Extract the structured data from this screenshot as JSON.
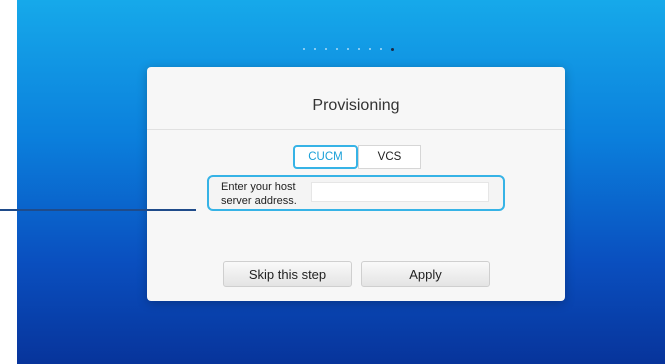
{
  "progress": {
    "total_steps": 9,
    "current_step": 9
  },
  "dialog": {
    "title": "Provisioning",
    "modes": [
      {
        "label": "CUCM",
        "selected": true
      },
      {
        "label": "VCS",
        "selected": false
      }
    ],
    "host_field": {
      "label_line1": "Enter your host",
      "label_line2": "server address.",
      "value": ""
    },
    "buttons": {
      "skip": "Skip this step",
      "apply": "Apply"
    }
  },
  "colors": {
    "accent": "#36b3e6",
    "background_top": "#16a9ea",
    "background_bottom": "#07349b",
    "callout": "#1f4b8a"
  }
}
